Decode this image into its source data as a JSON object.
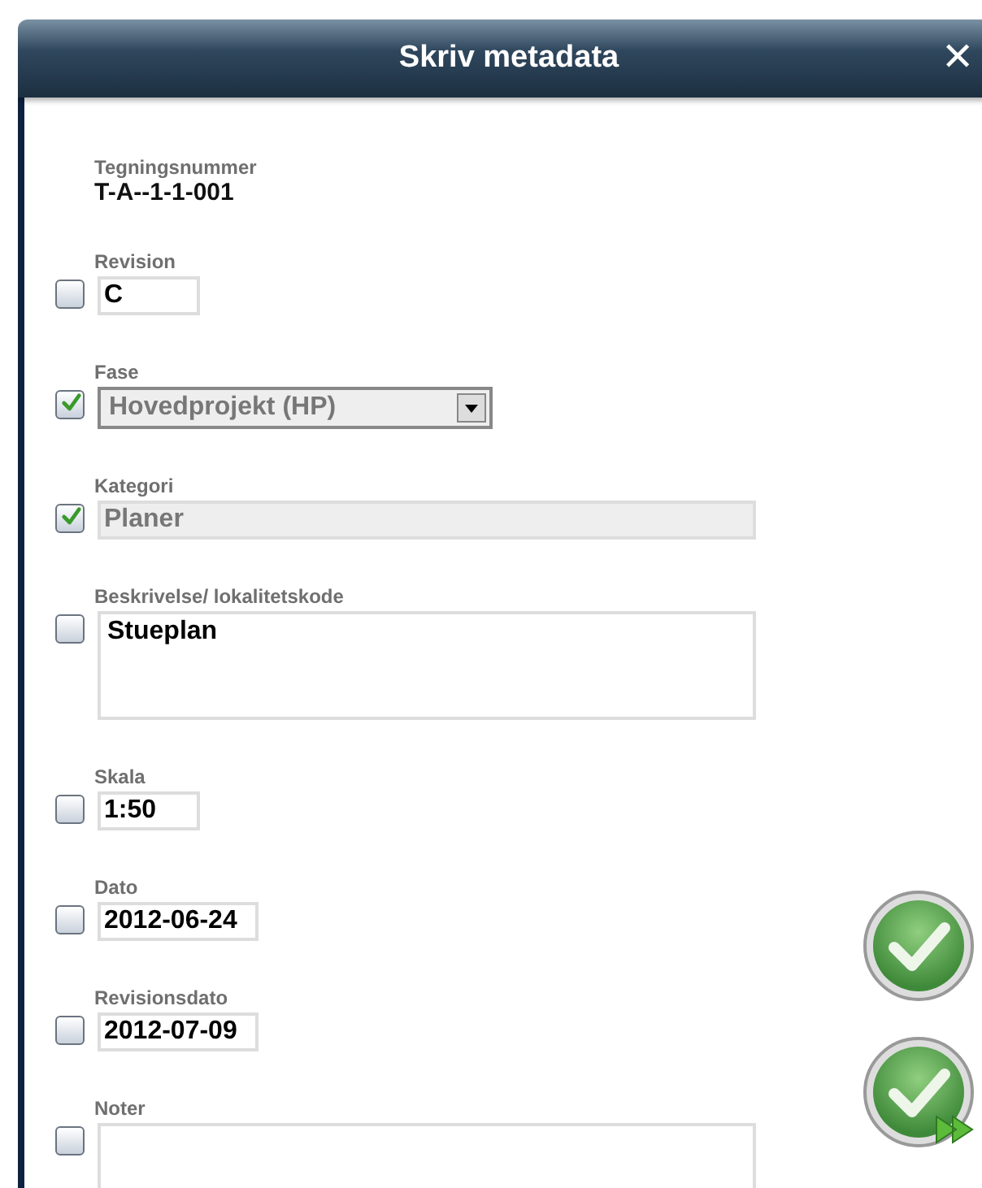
{
  "window": {
    "title": "Skriv metadata",
    "close": "✕"
  },
  "drawing_number": {
    "label": "Tegningsnummer",
    "value": "T-A--1-1-001"
  },
  "fields": [
    {
      "kind": "short",
      "label": "Revision",
      "value": "C",
      "checked": false
    },
    {
      "kind": "select",
      "label": "Fase",
      "value": "Hovedprojekt (HP)",
      "checked": true
    },
    {
      "kind": "readonly",
      "label": "Kategori",
      "value": "Planer",
      "checked": true
    },
    {
      "kind": "textarea",
      "label": "Beskrivelse/ lokalitetskode",
      "value": "Stueplan",
      "checked": false
    },
    {
      "kind": "short",
      "label": "Skala",
      "value": "1:50",
      "checked": false
    },
    {
      "kind": "date",
      "label": "Dato",
      "value": "2012-06-24",
      "checked": false
    },
    {
      "kind": "date",
      "label": "Revisionsdato",
      "value": "2012-07-09",
      "checked": false
    },
    {
      "kind": "textarea",
      "label": "Noter",
      "checked": false
    }
  ]
}
